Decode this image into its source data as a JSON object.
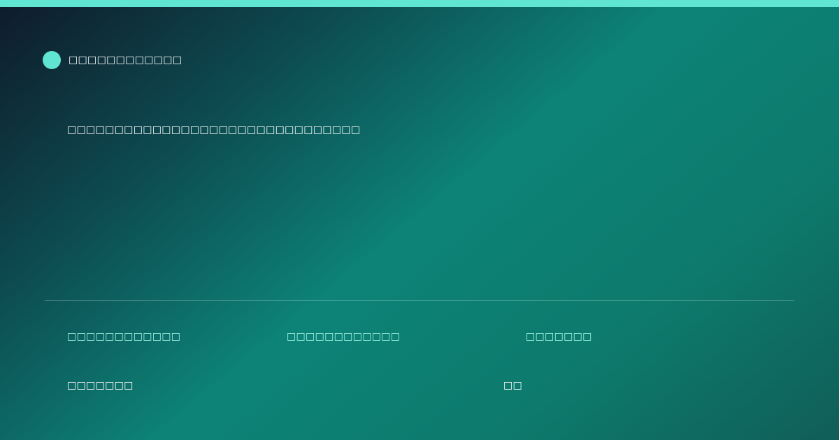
{
  "theme": {
    "accent": "#5fe5d1",
    "label_color": "#9ff4e4",
    "text_color": "#ffffff",
    "gradient_stops": [
      "#0f1a2a",
      "#0d4a50",
      "#0d8377",
      "#0d7a6d",
      "#105e57"
    ]
  },
  "brand": {
    "icon": "circle-dot-icon",
    "name": "□□□□□□□□□□□□"
  },
  "headline": "□□□□□□□□□□□□□□□□□□□□□□□□□□□□□□□",
  "meta": {
    "labels": [
      "□□□□□□□□□□□□",
      "□□□□□□□□□□□□",
      "□□□□□□□"
    ],
    "values": [
      "□□□□□□□",
      "□□"
    ]
  }
}
